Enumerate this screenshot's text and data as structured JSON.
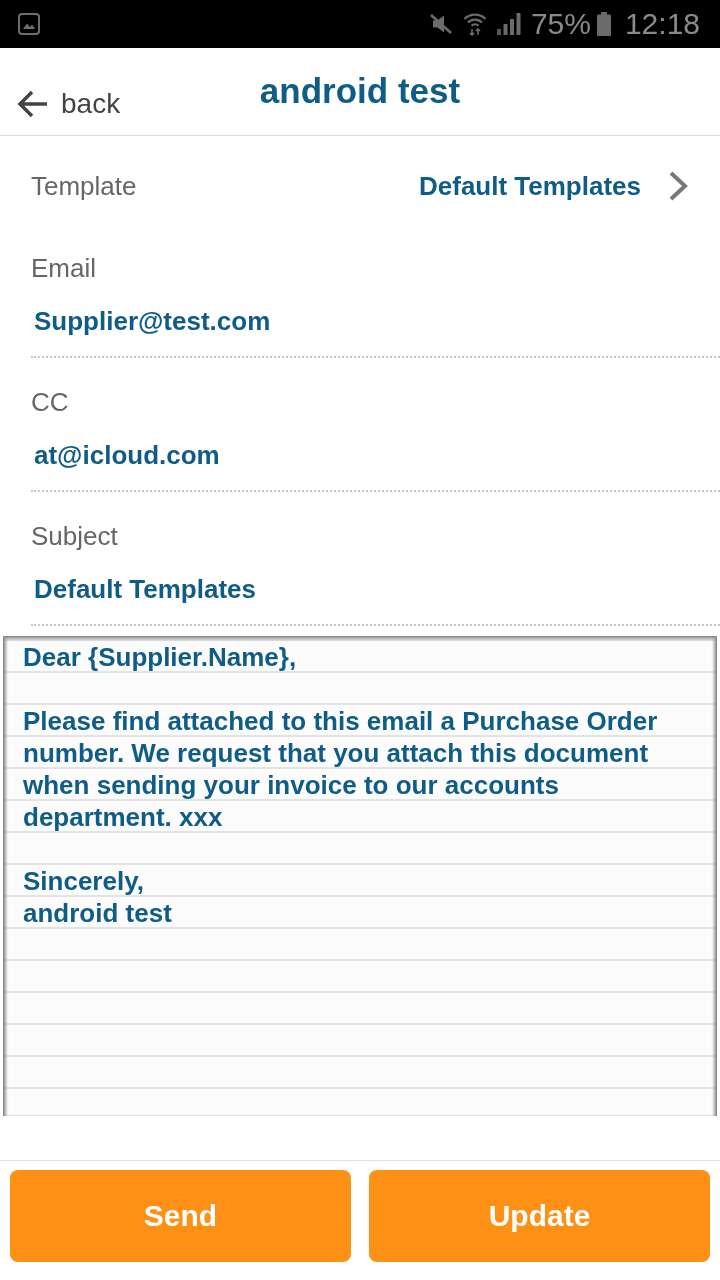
{
  "status_bar": {
    "battery": "75%",
    "time": "12:18"
  },
  "header": {
    "back": "back",
    "title": "android test"
  },
  "template": {
    "label": "Template",
    "value": "Default Templates"
  },
  "fields": [
    {
      "label": "Email",
      "value": "Supplier@test.com"
    },
    {
      "label": "CC",
      "value": "at@icloud.com"
    },
    {
      "label": "Subject",
      "value": "Default Templates"
    }
  ],
  "body": {
    "paragraphs": [
      "Dear {Supplier.Name},",
      "Please find attached to this email a Purchase Order number. We request that you attach this document when sending your invoice to our accounts department. xxx",
      "Sincerely,\nandroid test"
    ]
  },
  "buttons": [
    "Send",
    "Update"
  ]
}
